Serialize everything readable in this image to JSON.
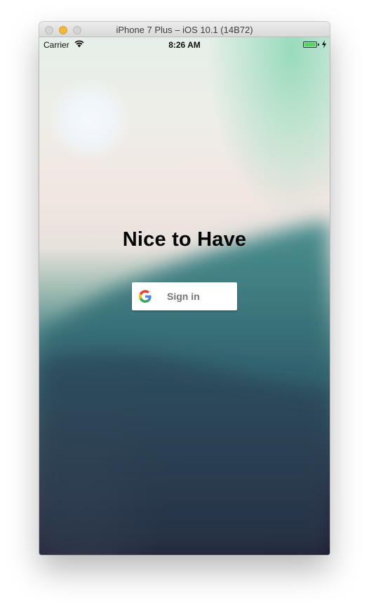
{
  "window": {
    "title": "iPhone 7 Plus – iOS 10.1 (14B72)"
  },
  "status_bar": {
    "carrier": "Carrier",
    "time": "8:26 AM",
    "battery_level": 1.0,
    "charging": true
  },
  "app": {
    "title": "Nice to Have",
    "sign_in_label": "Sign in"
  },
  "icons": {
    "window_controls": [
      "close-icon",
      "minimize-icon",
      "zoom-icon"
    ],
    "status": [
      "wifi-icon",
      "battery-icon",
      "charging-bolt-icon"
    ],
    "sign_in": "google-icon"
  },
  "colors": {
    "battery_fill": "#4cd964",
    "button_background": "#ffffff",
    "button_text": "#757575",
    "title_text": "#050505",
    "minimize_button": "#f2b83a"
  }
}
